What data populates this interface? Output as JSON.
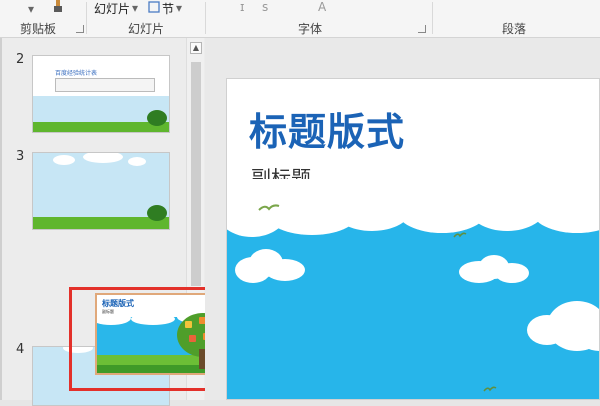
{
  "ribbon": {
    "groups": {
      "clipboard": "剪贴板",
      "slides": "幻灯片",
      "font": "字体",
      "paragraph": "段落"
    },
    "buttons": {
      "new_slide": "幻灯片",
      "section": "节"
    },
    "icons": [
      "paintbrush-icon",
      "dropdown-arrow-icon",
      "section-icon",
      "dialog-launcher-icon"
    ]
  },
  "slide_panel": {
    "slides": [
      {
        "number": "2",
        "label": "百度经验统计表"
      },
      {
        "number": "3",
        "label": ""
      },
      {
        "number": "4",
        "label": ""
      }
    ]
  },
  "dragged_slide": {
    "title": "标题版式",
    "subtitle": "副标题"
  },
  "current_slide": {
    "title": "标题版式",
    "subtitle": "副标题"
  },
  "colors": {
    "title_blue": "#1b63b6",
    "sky_blue": "#27b5ea",
    "highlight_red": "#e3302a",
    "grass_green": "#5fb62e"
  }
}
